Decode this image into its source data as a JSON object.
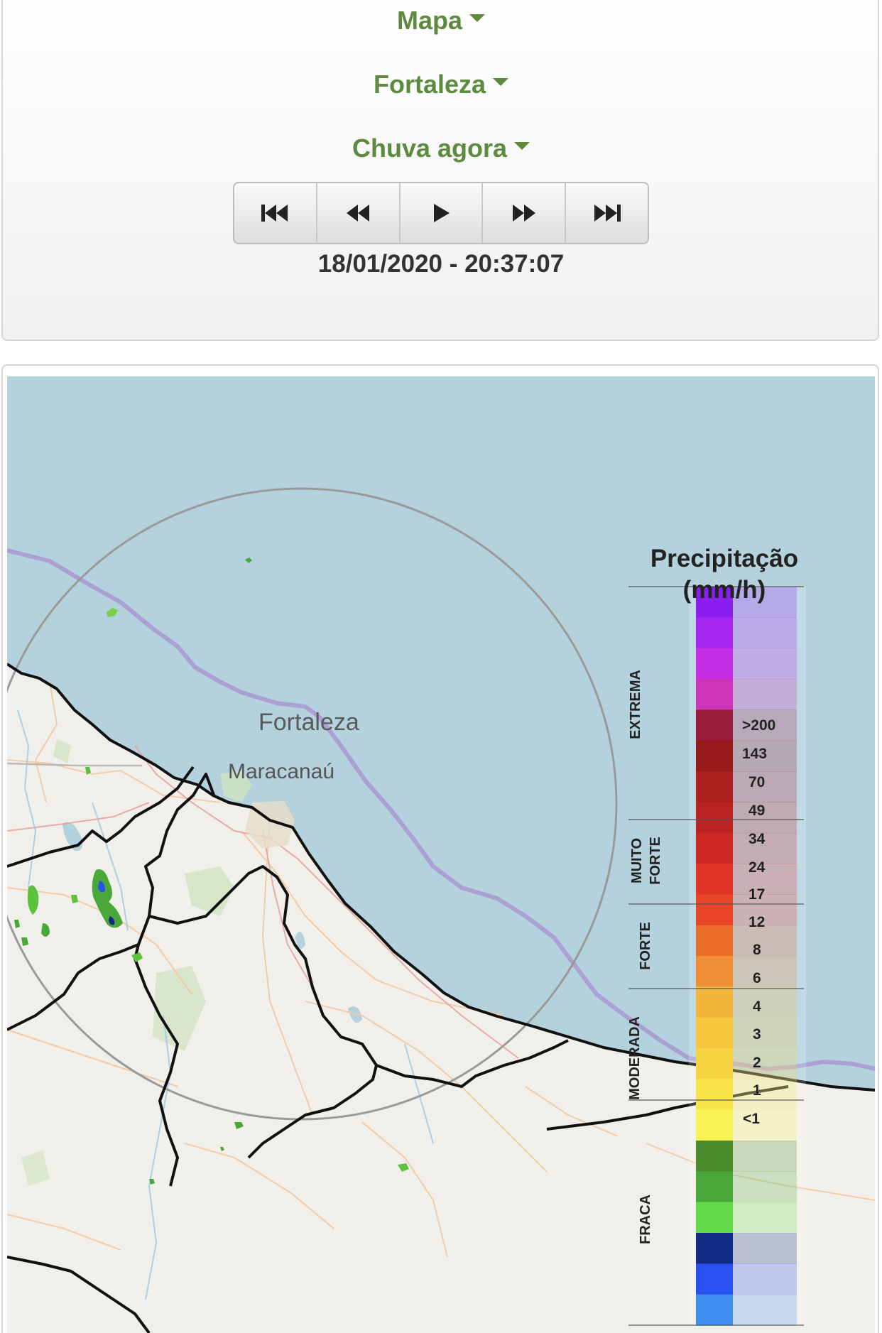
{
  "controls": {
    "map_menu": "Mapa",
    "city_menu": "Fortaleza",
    "product_menu": "Chuva agora",
    "playback_buttons": [
      {
        "name": "first-frame-button",
        "icon": "skip-to-start-icon"
      },
      {
        "name": "previous-frame-button",
        "icon": "rewind-icon"
      },
      {
        "name": "play-button",
        "icon": "play-icon"
      },
      {
        "name": "next-frame-button",
        "icon": "fast-forward-icon"
      },
      {
        "name": "last-frame-button",
        "icon": "skip-to-end-icon"
      }
    ],
    "timestamp": "18/01/2020 - 20:37:07"
  },
  "map": {
    "labels": {
      "city": "Fortaleza",
      "suburb": "Maracanaú"
    },
    "colors": {
      "sea": "#b4d1de",
      "land": "#f1efe9",
      "boundary": "#111111",
      "sea_line": "#a89ad0",
      "radar_ring": "#9a9a9a"
    }
  },
  "legend": {
    "title_line1": "Precipitação",
    "title_line2": "(mm/h)",
    "categories": [
      "EXTREMA",
      "MUITO FORTE",
      "FORTE",
      "MODERADA",
      "FRACA"
    ],
    "ticks": [
      ">200",
      "143",
      "70",
      "49",
      "34",
      "24",
      "17",
      "12",
      "8",
      "6",
      "4",
      "3",
      "2",
      "1",
      "<1"
    ],
    "colors": [
      "#8a1ef0",
      "#a526ee",
      "#c42ee6",
      "#cd34b8",
      "#9a1c3a",
      "#971a1a",
      "#ad1f1f",
      "#bb2222",
      "#cc2722",
      "#e2352a",
      "#ea4428",
      "#ec6c2b",
      "#ef8e35",
      "#f3b63a",
      "#f6c63c",
      "#f6d441",
      "#f8e449",
      "#f8f455",
      "#4a8a2a",
      "#4aa83a",
      "#62da48",
      "#142b85",
      "#2950f0",
      "#3f8ff0"
    ]
  }
}
